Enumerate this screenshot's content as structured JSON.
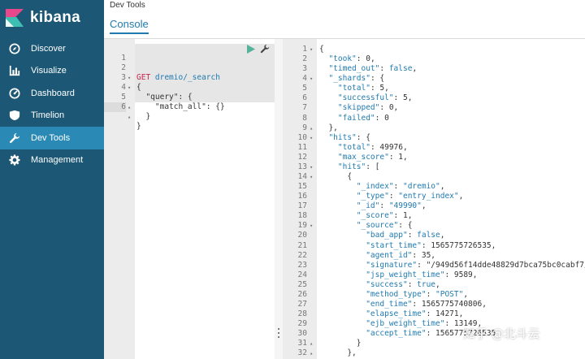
{
  "brand": {
    "name": "kibana"
  },
  "nav": [
    {
      "label": "Discover",
      "icon": "compass-icon",
      "active": false
    },
    {
      "label": "Visualize",
      "icon": "bar-chart-icon",
      "active": false
    },
    {
      "label": "Dashboard",
      "icon": "dashboard-icon",
      "active": false
    },
    {
      "label": "Timelion",
      "icon": "shield-icon",
      "active": false
    },
    {
      "label": "Dev Tools",
      "icon": "wrench-icon",
      "active": true
    },
    {
      "label": "Management",
      "icon": "gear-icon",
      "active": false
    }
  ],
  "header": {
    "title": "Dev Tools",
    "tab": "Console"
  },
  "editor": {
    "lines": [
      {
        "n": "1",
        "fold": "",
        "method": "GET",
        "url": " dremio/_search"
      },
      {
        "n": "2",
        "fold": "▾",
        "code": "{"
      },
      {
        "n": "3",
        "fold": "▾",
        "code": "  \"query\": {"
      },
      {
        "n": "4",
        "fold": "",
        "code": "    \"match_all\": {}"
      },
      {
        "n": "5",
        "fold": "▴",
        "code": "  }"
      },
      {
        "n": "6",
        "fold": "▴",
        "code": "}"
      }
    ]
  },
  "output": {
    "lines": [
      {
        "n": "1",
        "fold": "▾",
        "code": "{"
      },
      {
        "n": "2",
        "fold": "",
        "code": "  \"took\": 0,"
      },
      {
        "n": "3",
        "fold": "",
        "code": "  \"timed_out\": false,"
      },
      {
        "n": "4",
        "fold": "▾",
        "code": "  \"_shards\": {"
      },
      {
        "n": "5",
        "fold": "",
        "code": "    \"total\": 5,"
      },
      {
        "n": "6",
        "fold": "",
        "code": "    \"successful\": 5,"
      },
      {
        "n": "7",
        "fold": "",
        "code": "    \"skipped\": 0,"
      },
      {
        "n": "8",
        "fold": "",
        "code": "    \"failed\": 0"
      },
      {
        "n": "9",
        "fold": "▴",
        "code": "  },"
      },
      {
        "n": "10",
        "fold": "▾",
        "code": "  \"hits\": {"
      },
      {
        "n": "11",
        "fold": "",
        "code": "    \"total\": 49976,"
      },
      {
        "n": "12",
        "fold": "",
        "code": "    \"max_score\": 1,"
      },
      {
        "n": "13",
        "fold": "▾",
        "code": "    \"hits\": ["
      },
      {
        "n": "14",
        "fold": "▾",
        "code": "      {"
      },
      {
        "n": "15",
        "fold": "",
        "code": "        \"_index\": \"dremio\","
      },
      {
        "n": "16",
        "fold": "",
        "code": "        \"_type\": \"entry_index\","
      },
      {
        "n": "17",
        "fold": "",
        "code": "        \"_id\": \"49990\","
      },
      {
        "n": "18",
        "fold": "",
        "code": "        \"_score\": 1,"
      },
      {
        "n": "19",
        "fold": "▾",
        "code": "        \"_source\": {"
      },
      {
        "n": "20",
        "fold": "",
        "code": "          \"bad_app\": false,"
      },
      {
        "n": "21",
        "fold": "",
        "code": "          \"start_time\": 1565775726535,"
      },
      {
        "n": "22",
        "fold": "",
        "code": "          \"agent_id\": 35,"
      },
      {
        "n": "23",
        "fold": "",
        "code": "          \"signature\": \"/949d56f14dde48829d7bca75bc0cabf7/"
      },
      {
        "n": "24",
        "fold": "",
        "code": "          \"jsp_weight_time\": 9589,"
      },
      {
        "n": "25",
        "fold": "",
        "code": "          \"success\": true,"
      },
      {
        "n": "26",
        "fold": "",
        "code": "          \"method_type\": \"POST\","
      },
      {
        "n": "27",
        "fold": "",
        "code": "          \"end_time\": 1565775740806,"
      },
      {
        "n": "28",
        "fold": "",
        "code": "          \"elapse_time\": 14271,"
      },
      {
        "n": "29",
        "fold": "",
        "code": "          \"ejb_weight_time\": 13149,"
      },
      {
        "n": "30",
        "fold": "",
        "code": "          \"accept_time\": 1565775726535"
      },
      {
        "n": "31",
        "fold": "▴",
        "code": "        }"
      },
      {
        "n": "32",
        "fold": "▴",
        "code": "      },"
      }
    ]
  },
  "watermark": "知乎 @北斗云",
  "colors": {
    "sidebar": "#1c5875",
    "active_nav": "#2a8ab5",
    "accent": "#1f7ab0",
    "method": "#c7254e",
    "run": "#54b399"
  }
}
